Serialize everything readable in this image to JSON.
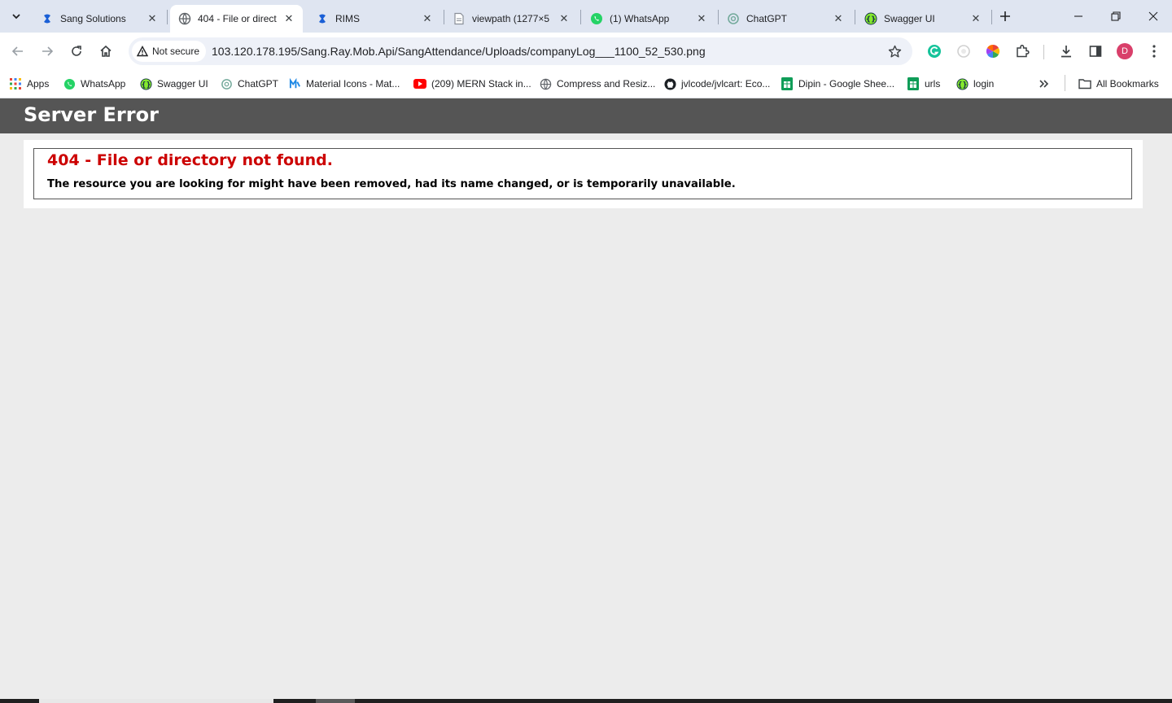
{
  "tabs": [
    {
      "title": "Sang Solutions",
      "icon": "sang-logo-icon",
      "active": false
    },
    {
      "title": "404 - File or direct",
      "icon": "globe-icon",
      "active": true
    },
    {
      "title": "RIMS",
      "icon": "sang-logo-icon",
      "active": false
    },
    {
      "title": "viewpath (1277×5",
      "icon": "document-icon",
      "active": false
    },
    {
      "title": "(1) WhatsApp",
      "icon": "whatsapp-icon",
      "active": false
    },
    {
      "title": "ChatGPT",
      "icon": "chatgpt-icon",
      "active": false
    },
    {
      "title": "Swagger UI",
      "icon": "swagger-icon",
      "active": false
    }
  ],
  "addressbar": {
    "security_label": "Not secure",
    "url": "103.120.178.195/Sang.Ray.Mob.Api/SangAttendance/Uploads/companyLog___1100_52_530.png"
  },
  "profile_initial": "D",
  "bookmarks": {
    "items": [
      {
        "label": "Apps",
        "icon": "apps-grid-icon"
      },
      {
        "label": "WhatsApp",
        "icon": "whatsapp-icon"
      },
      {
        "label": "Swagger UI",
        "icon": "swagger-icon"
      },
      {
        "label": "ChatGPT",
        "icon": "chatgpt-icon"
      },
      {
        "label": "Material Icons - Mat...",
        "icon": "material-icons-icon"
      },
      {
        "label": "(209) MERN Stack in...",
        "icon": "youtube-icon"
      },
      {
        "label": "Compress and Resiz...",
        "icon": "globe-icon"
      },
      {
        "label": "jvlcode/jvlcart: Eco...",
        "icon": "github-icon"
      },
      {
        "label": "Dipin - Google Shee...",
        "icon": "sheets-icon"
      },
      {
        "label": "urls",
        "icon": "sheets-icon"
      },
      {
        "label": "login",
        "icon": "swagger-icon"
      }
    ],
    "all_bookmarks": "All Bookmarks"
  },
  "page": {
    "header": "Server Error",
    "error_title": "404 - File or directory not found.",
    "error_description": "The resource you are looking for might have been removed, had its name changed, or is temporarily unavailable."
  },
  "colors": {
    "header_bg": "#555555",
    "error_red": "#cc0000",
    "page_bg": "#ececec",
    "tabstrip_bg": "#dfe5f1"
  }
}
